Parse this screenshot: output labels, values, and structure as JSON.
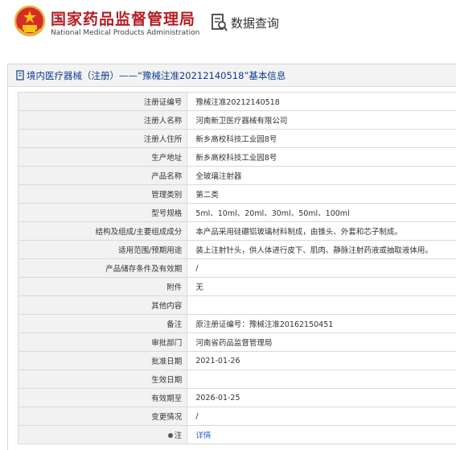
{
  "header": {
    "agency_cn": "国家药品监督管理局",
    "agency_en": "National Medical Products Administration",
    "search_label": "数据查询"
  },
  "panel": {
    "title": "境内医疗器械（注册）——“豫械注准20212140518”基本信息"
  },
  "rows": [
    {
      "label": "注册证编号",
      "value": "豫械注准20212140518"
    },
    {
      "label": "注册人名称",
      "value": "河南新卫医疗器械有限公司"
    },
    {
      "label": "注册人住所",
      "value": "新乡高校科技工业园8号"
    },
    {
      "label": "生产地址",
      "value": "新乡高校科技工业园8号"
    },
    {
      "label": "产品名称",
      "value": "全玻璃注射器"
    },
    {
      "label": "管理类别",
      "value": "第二类"
    },
    {
      "label": "型号规格",
      "value": "5ml、10ml、20ml、30ml、50ml、100ml"
    },
    {
      "label": "结构及组成/主要组成成分",
      "value": "本产品采用硅硼铝玻璃材料制成，由锥头、外套和芯子制成。"
    },
    {
      "label": "适用范围/预期用途",
      "value": "装上注射针头，供人体进行皮下、肌肉、静脉注射药液或抽取液体用。"
    },
    {
      "label": "产品储存条件及有效期",
      "value": "/"
    },
    {
      "label": "附件",
      "value": "无"
    },
    {
      "label": "其他内容",
      "value": ""
    },
    {
      "label": "备注",
      "value": "原注册证编号：豫械注准20162150451"
    },
    {
      "label": "审批部门",
      "value": "河南省药品监督管理局"
    },
    {
      "label": "批准日期",
      "value": "2021-01-26"
    },
    {
      "label": "生效日期",
      "value": ""
    },
    {
      "label": "有效期至",
      "value": "2026-01-25"
    },
    {
      "label": "变更情况",
      "value": "/"
    }
  ],
  "note": {
    "label": "注",
    "link_text": "详情"
  }
}
